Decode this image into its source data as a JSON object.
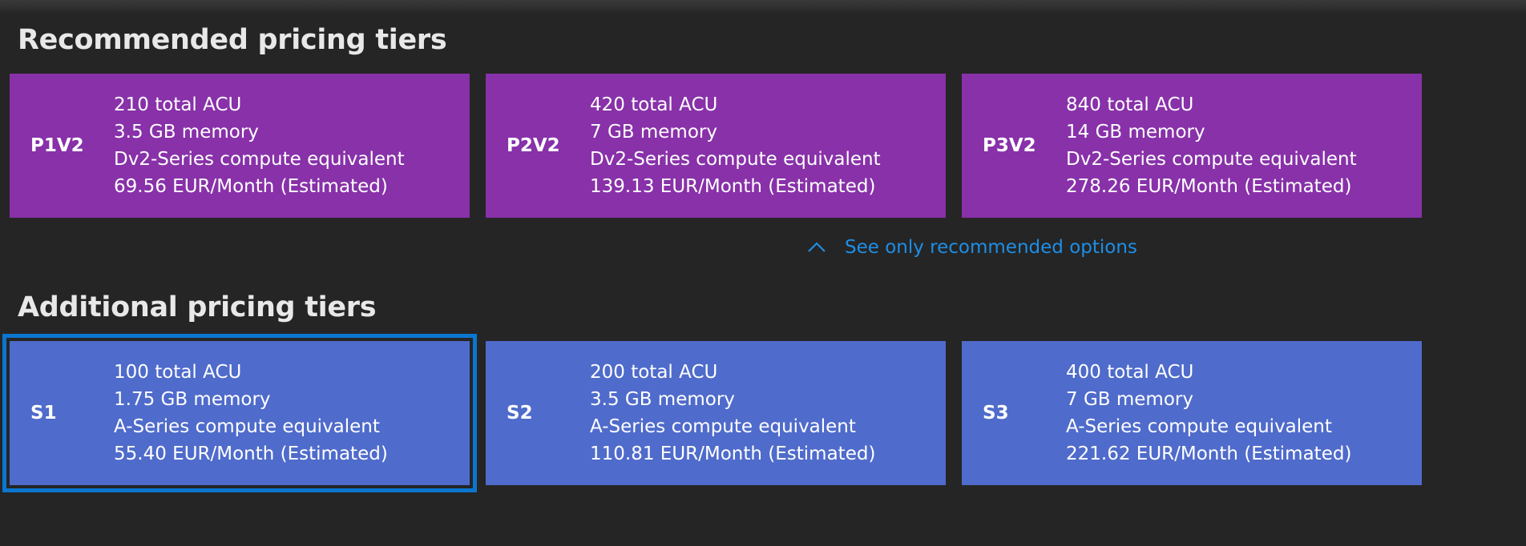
{
  "recommended": {
    "title": "Recommended pricing tiers",
    "tiers": [
      {
        "name": "P1V2",
        "acu": "210 total ACU",
        "memory": "3.5 GB memory",
        "compute": "Dv2-Series compute equivalent",
        "price": "69.56 EUR/Month (Estimated)"
      },
      {
        "name": "P2V2",
        "acu": "420 total ACU",
        "memory": "7 GB memory",
        "compute": "Dv2-Series compute equivalent",
        "price": "139.13 EUR/Month (Estimated)"
      },
      {
        "name": "P3V2",
        "acu": "840 total ACU",
        "memory": "14 GB memory",
        "compute": "Dv2-Series compute equivalent",
        "price": "278.26 EUR/Month (Estimated)"
      }
    ],
    "color": "#8831a9"
  },
  "toggle": {
    "label": "See only recommended options",
    "icon": "chevron-up-icon",
    "color": "#1e8ee6"
  },
  "additional": {
    "title": "Additional pricing tiers",
    "tiers": [
      {
        "name": "S1",
        "acu": "100 total ACU",
        "memory": "1.75 GB memory",
        "compute": "A-Series compute equivalent",
        "price": "55.40 EUR/Month (Estimated)",
        "selected": true
      },
      {
        "name": "S2",
        "acu": "200 total ACU",
        "memory": "3.5 GB memory",
        "compute": "A-Series compute equivalent",
        "price": "110.81 EUR/Month (Estimated)"
      },
      {
        "name": "S3",
        "acu": "400 total ACU",
        "memory": "7 GB memory",
        "compute": "A-Series compute equivalent",
        "price": "221.62 EUR/Month (Estimated)"
      }
    ],
    "color": "#4f6bcb",
    "selection_color": "#0b76d0"
  }
}
